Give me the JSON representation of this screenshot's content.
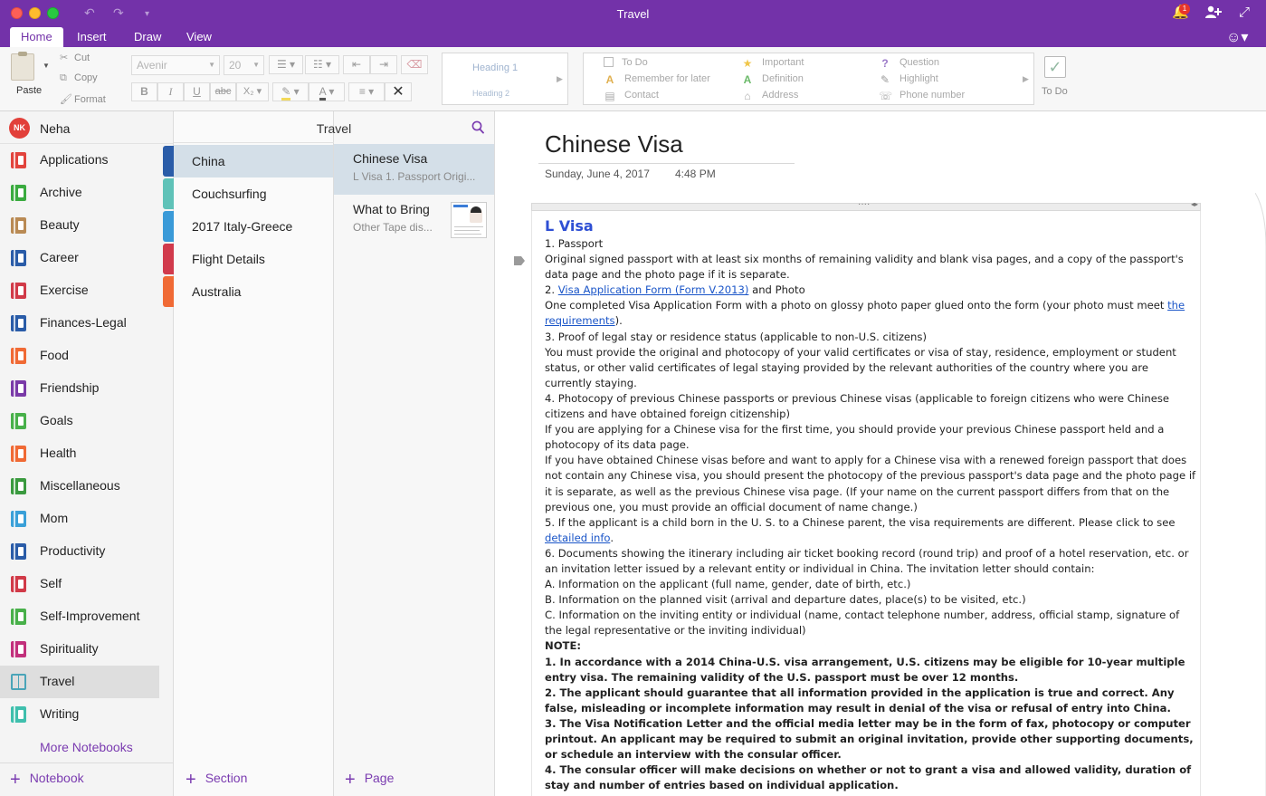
{
  "window": {
    "title": "Travel",
    "notification_count": "1"
  },
  "tabs": [
    "Home",
    "Insert",
    "Draw",
    "View"
  ],
  "ribbon": {
    "paste": "Paste",
    "cut": "Cut",
    "copy": "Copy",
    "format": "Format",
    "font": "Avenir",
    "size": "20",
    "styles": {
      "heading1": "Heading 1",
      "heading2": "Heading 2"
    },
    "tags": {
      "todo": "To Do",
      "remember": "Remember for later",
      "contact": "Contact",
      "important": "Important",
      "definition": "Definition",
      "address": "Address",
      "question": "Question",
      "highlight": "Highlight",
      "phone": "Phone number"
    },
    "todo_tag": "To Do"
  },
  "user": {
    "initials": "NK",
    "name": "Neha"
  },
  "notebooks": [
    {
      "name": "Applications",
      "color": "#e2443d"
    },
    {
      "name": "Archive",
      "color": "#3aab3f"
    },
    {
      "name": "Beauty",
      "color": "#b98a54"
    },
    {
      "name": "Career",
      "color": "#2a5ca8"
    },
    {
      "name": "Exercise",
      "color": "#d13a48"
    },
    {
      "name": "Finances-Legal",
      "color": "#2a5ca8"
    },
    {
      "name": "Food",
      "color": "#f06a35"
    },
    {
      "name": "Friendship",
      "color": "#7a3aa8"
    },
    {
      "name": "Goals",
      "color": "#48b04a"
    },
    {
      "name": "Health",
      "color": "#f06a35"
    },
    {
      "name": "Miscellaneous",
      "color": "#3a9a3f"
    },
    {
      "name": "Mom",
      "color": "#3aa0d8"
    },
    {
      "name": "Productivity",
      "color": "#2a5ca8"
    },
    {
      "name": "Self",
      "color": "#d13a48"
    },
    {
      "name": "Self-Improvement",
      "color": "#48b04a"
    },
    {
      "name": "Spirituality",
      "color": "#c2307c"
    },
    {
      "name": "Travel",
      "color": "#4aa4b8"
    },
    {
      "name": "Writing",
      "color": "#3fbfad"
    }
  ],
  "more_notebooks": "More Notebooks",
  "notebook_title": "Travel",
  "sections": [
    {
      "name": "China",
      "color": "#2a5ca8"
    },
    {
      "name": "Couchsurfing",
      "color": "#5fc2b8"
    },
    {
      "name": "2017 Italy-Greece",
      "color": "#3a9ad8"
    },
    {
      "name": "Flight Details",
      "color": "#d13a4c"
    },
    {
      "name": "Australia",
      "color": "#f06a35"
    }
  ],
  "pages": [
    {
      "title": "Chinese Visa",
      "preview": "L Visa  1. Passport  Origi..."
    },
    {
      "title": "What to Bring",
      "preview": "Other  Tape dis..."
    }
  ],
  "footer": {
    "notebook": "Notebook",
    "section": "Section",
    "page": "Page"
  },
  "page": {
    "title": "Chinese Visa",
    "date": "Sunday, June 4, 2017",
    "time": "4:48 PM",
    "heading": "L Visa",
    "lines": [
      {
        "t": "1. Passport"
      },
      {
        "t": "Original signed passport with at least six months of remaining validity and blank visa pages, and a copy of the passport's data page and the photo page if it is separate."
      },
      {
        "pre": "2. ",
        "link": "Visa Application Form (Form V.2013)",
        "post": " and Photo"
      },
      {
        "t": "One completed Visa Application Form with a photo on glossy photo paper glued onto the form (your photo must meet ",
        "link": "the requirements",
        "post": ")."
      },
      {
        "t": "3. Proof of legal stay or residence status (applicable to non-U.S. citizens)"
      },
      {
        "t": "You must provide the original and photocopy of your valid certificates or visa of stay, residence, employment or student status, or other valid certificates of legal staying provided by the relevant authorities of the country where you are currently staying."
      },
      {
        "t": "4. Photocopy of previous Chinese passports or previous Chinese visas (applicable to foreign citizens who were Chinese citizens and have obtained foreign citizenship)"
      },
      {
        "t": "If you are applying for a Chinese visa for the first time, you should provide your previous Chinese passport held and a photocopy of its data page."
      },
      {
        "t": "If you have obtained Chinese visas before and want to apply for a Chinese visa with a renewed foreign passport that does not contain any Chinese visa, you should present the photocopy of the previous passport's data page and the photo page if it is separate, as well as the previous Chinese visa page. (If your name on the current passport differs from that on the previous one, you must provide an official document of name change.)"
      },
      {
        "t": "5. If the applicant is a child born in the U. S. to a Chinese parent, the visa requirements are different.  Please click to see ",
        "link": "detailed info",
        "post": "."
      },
      {
        "t": "6. Documents showing the itinerary including air ticket booking record (round trip) and proof of a hotel reservation, etc. or an invitation letter issued by a relevant entity or individual in China. The invitation letter should contain:"
      },
      {
        "t": "A.  Information on the applicant (full name, gender, date of birth, etc.)"
      },
      {
        "t": "B.  Information on the planned visit (arrival and departure dates, place(s) to be visited, etc.)"
      },
      {
        "t": "C.  Information on the inviting entity or individual (name, contact telephone number, address, official stamp, signature of the legal representative or the inviting individual)"
      },
      {
        "t": "NOTE:",
        "bold": true
      },
      {
        "t": "1. In accordance with a 2014 China-U.S.  visa arrangement, U.S. citizens may be eligible  for  10-year multiple entry visa. The remaining validity of the U.S. passport must be over 12 months.",
        "bold": true
      },
      {
        "t": "2. The applicant should guarantee that all information provided in the application is true and correct. Any false,  misleading or incomplete information may result in denial of the visa or refusal of entry into China.",
        "bold": true
      },
      {
        "t": "3. The Visa Notification Letter and the official  media letter may be in the form of fax, photocopy or computer printout. An applicant may be required to submit an original invitation, provide other supporting documents, or schedule an interview with the consular officer.",
        "bold": true
      },
      {
        "t": "4. The consular officer will  make decisions on whether or not to grant a visa and allowed validity, duration of stay and number of entries based on individual application.",
        "bold": true
      }
    ]
  }
}
